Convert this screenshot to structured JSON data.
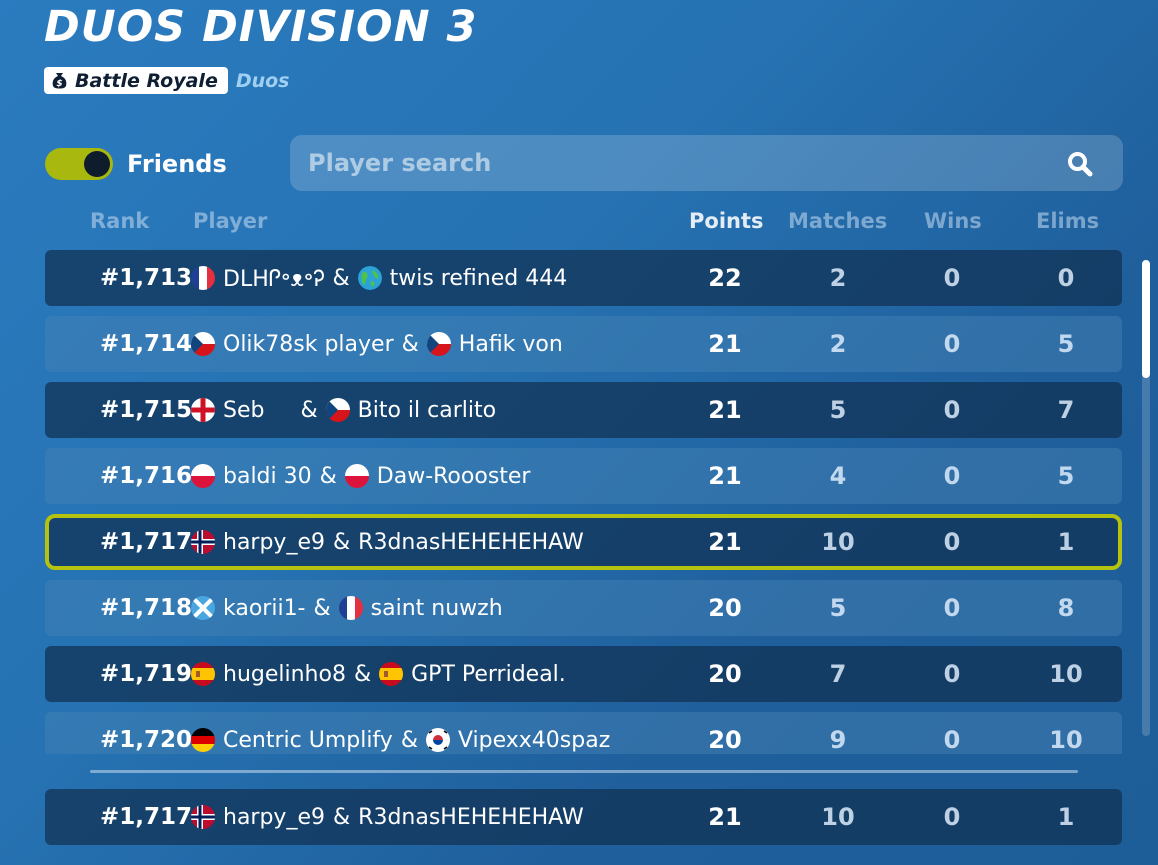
{
  "title": "DUOS DIVISION 3",
  "mode": {
    "badge": "Battle Royale",
    "sub": "Duos",
    "badge_icon": "money-bag-icon"
  },
  "friends": {
    "label": "Friends",
    "enabled": true
  },
  "search": {
    "placeholder": "Player search"
  },
  "columns": {
    "rank": "Rank",
    "player": "Player",
    "points": "Points",
    "matches": "Matches",
    "wins": "Wins",
    "elims": "Elims"
  },
  "rows": [
    {
      "rank": "#1,713",
      "p1": "DLHᎵ॰ᴥ॰Ꭾ",
      "f1": "fr",
      "p2": "twis refined 444",
      "f2": "globe",
      "points": "22",
      "matches": "2",
      "wins": "0",
      "elims": "0"
    },
    {
      "rank": "#1,714",
      "p1": "Olik78sk player",
      "f1": "cz",
      "p2": "Hafik von",
      "f2": "cz",
      "points": "21",
      "matches": "2",
      "wins": "0",
      "elims": "5"
    },
    {
      "rank": "#1,715",
      "p1": "Seb",
      "f1": "en",
      "p2": "Bito il carlito",
      "f2": "cz",
      "points": "21",
      "matches": "5",
      "wins": "0",
      "elims": "7"
    },
    {
      "rank": "#1,716",
      "p1": "baldi 30",
      "f1": "pl",
      "p2": "Daw-Roooster",
      "f2": "pl",
      "points": "21",
      "matches": "4",
      "wins": "0",
      "elims": "5"
    },
    {
      "rank": "#1,717",
      "p1": "harpy_e9",
      "f1": "no",
      "p2": "R3dnasHEHEHEHAW",
      "f2": "",
      "points": "21",
      "matches": "10",
      "wins": "0",
      "elims": "1",
      "highlighted": true
    },
    {
      "rank": "#1,718",
      "p1": "kaorii1-",
      "f1": "sc",
      "p2": "saint nuwzh",
      "f2": "fr",
      "points": "20",
      "matches": "5",
      "wins": "0",
      "elims": "8"
    },
    {
      "rank": "#1,719",
      "p1": "hugelinho8",
      "f1": "es",
      "p2": "GPT Perrideal.",
      "f2": "es",
      "points": "20",
      "matches": "7",
      "wins": "0",
      "elims": "10"
    },
    {
      "rank": "#1,720",
      "p1": "Centric Umplify",
      "f1": "de",
      "p2": "Vipexx40spaz",
      "f2": "kr",
      "points": "20",
      "matches": "9",
      "wins": "0",
      "elims": "10"
    }
  ],
  "my_row": {
    "rank": "#1,717",
    "p1": "harpy_e9",
    "f1": "no",
    "p2": "R3dnasHEHEHEHAW",
    "f2": "",
    "points": "21",
    "matches": "10",
    "wins": "0",
    "elims": "1"
  },
  "colors": {
    "accent": "#b6c30e",
    "background": "#2672b2"
  }
}
